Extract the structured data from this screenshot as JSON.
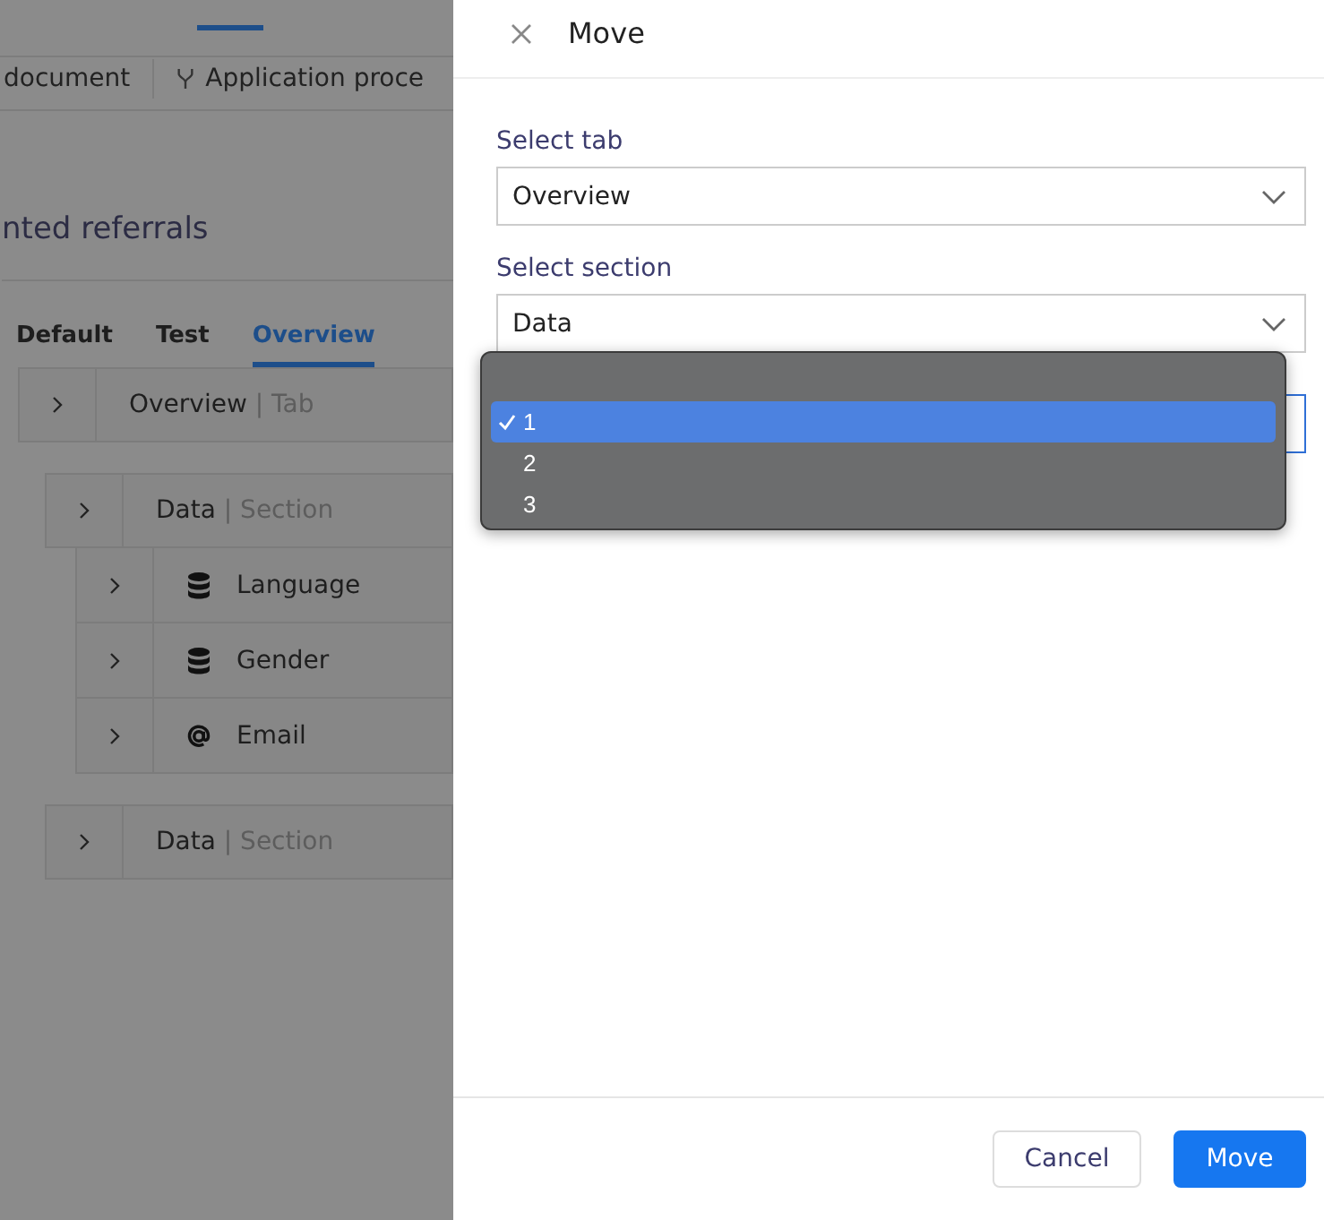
{
  "background": {
    "toolbar": [
      {
        "label": "document",
        "kind": "plain"
      },
      {
        "label": "Application proce",
        "kind": "fork"
      }
    ],
    "heading": "nted referrals",
    "tabs": [
      {
        "label": "Default",
        "selected": false
      },
      {
        "label": "Test",
        "selected": false
      },
      {
        "label": "Overview",
        "selected": true
      }
    ],
    "tree": [
      {
        "label": "Overview",
        "type": "| Tab",
        "children": [
          {
            "label": "Data",
            "type": "| Section",
            "children": [
              {
                "label": "Language",
                "kind": "database"
              },
              {
                "label": "Gender",
                "kind": "database"
              },
              {
                "label": "Email",
                "kind": "at"
              }
            ]
          },
          {
            "label": "Data",
            "type": "| Section"
          }
        ]
      }
    ]
  },
  "dialog": {
    "title": "Move",
    "fields": [
      {
        "label": "Select tab",
        "value": "Overview"
      },
      {
        "label": "Select section",
        "value": "Data"
      }
    ],
    "position_select": {
      "options": [
        {
          "label": "1",
          "selected": true
        },
        {
          "label": "2",
          "selected": false
        },
        {
          "label": "3",
          "selected": false
        }
      ]
    },
    "buttons": [
      {
        "label": "Cancel",
        "kind": "secondary"
      },
      {
        "label": "Move",
        "kind": "primary"
      }
    ]
  }
}
